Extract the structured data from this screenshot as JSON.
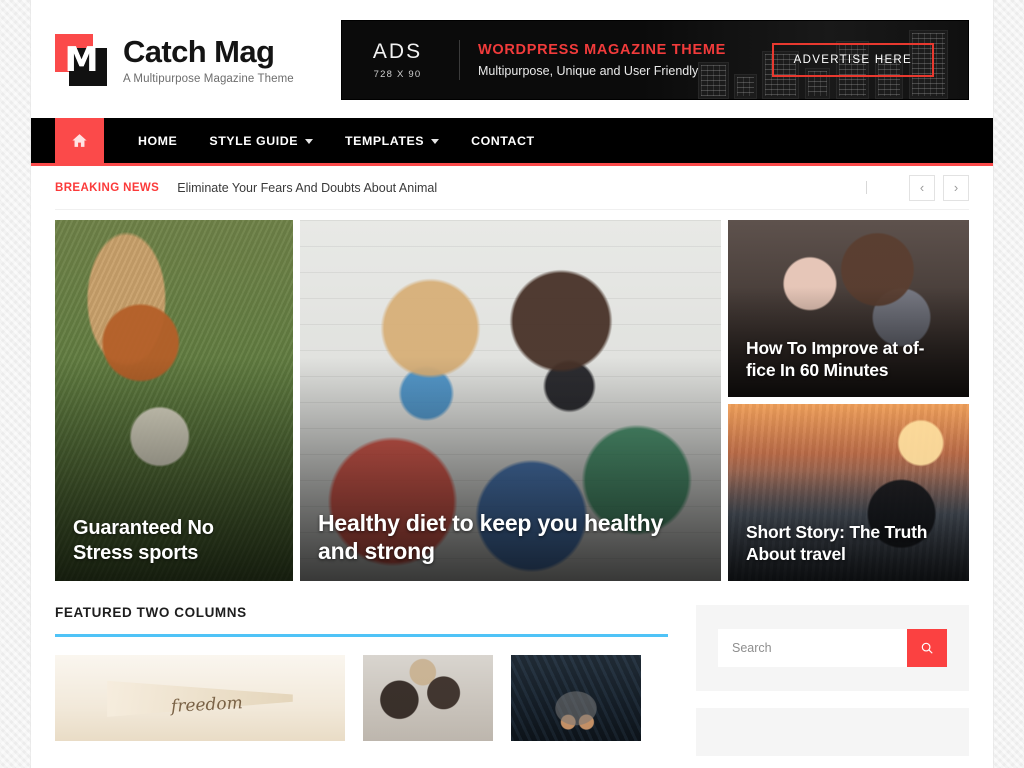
{
  "site": {
    "logo_letter": "M",
    "title": "Catch Mag",
    "description": "A Multipurpose Magazine Theme"
  },
  "ad": {
    "label": "ADS",
    "size": "728 X 90",
    "headline": "WORDPRESS MAGAZINE THEME",
    "subline": "Multipurpose, Unique and User Friendly",
    "cta": "ADVERTISE HERE"
  },
  "nav": {
    "home_icon": "home-icon",
    "items": [
      {
        "label": "HOME",
        "has_dropdown": false
      },
      {
        "label": "STYLE GUIDE",
        "has_dropdown": true
      },
      {
        "label": "TEMPLATES",
        "has_dropdown": true
      },
      {
        "label": "CONTACT",
        "has_dropdown": false
      }
    ]
  },
  "breaking": {
    "label": "BREAKING NEWS",
    "headline": "Eliminate Your Fears And Doubts About Animal",
    "prev_icon": "‹",
    "next_icon": "›"
  },
  "hero": {
    "tiles": [
      {
        "title": "Guaranteed No Stress sports"
      },
      {
        "title": "Healthy diet to keep you healthy and strong"
      },
      {
        "title": "How To Improve at of-fice In 60 Minutes"
      },
      {
        "title": "Short Story: The Truth About travel"
      }
    ]
  },
  "featured": {
    "section_title": "FEATURED TWO COLUMNS",
    "accent_color": "#4fc3f7",
    "thumbs": [
      {
        "name": "freedom-banner"
      },
      {
        "name": "office-meeting"
      },
      {
        "name": "shoes-overhead"
      }
    ]
  },
  "sidebar": {
    "search": {
      "placeholder": "Search",
      "button_icon": "search-icon",
      "button_color": "#fb4141"
    }
  },
  "theme": {
    "accent_red": "#fb4a4a",
    "nav_background": "#000000",
    "page_background": "#ececec"
  }
}
